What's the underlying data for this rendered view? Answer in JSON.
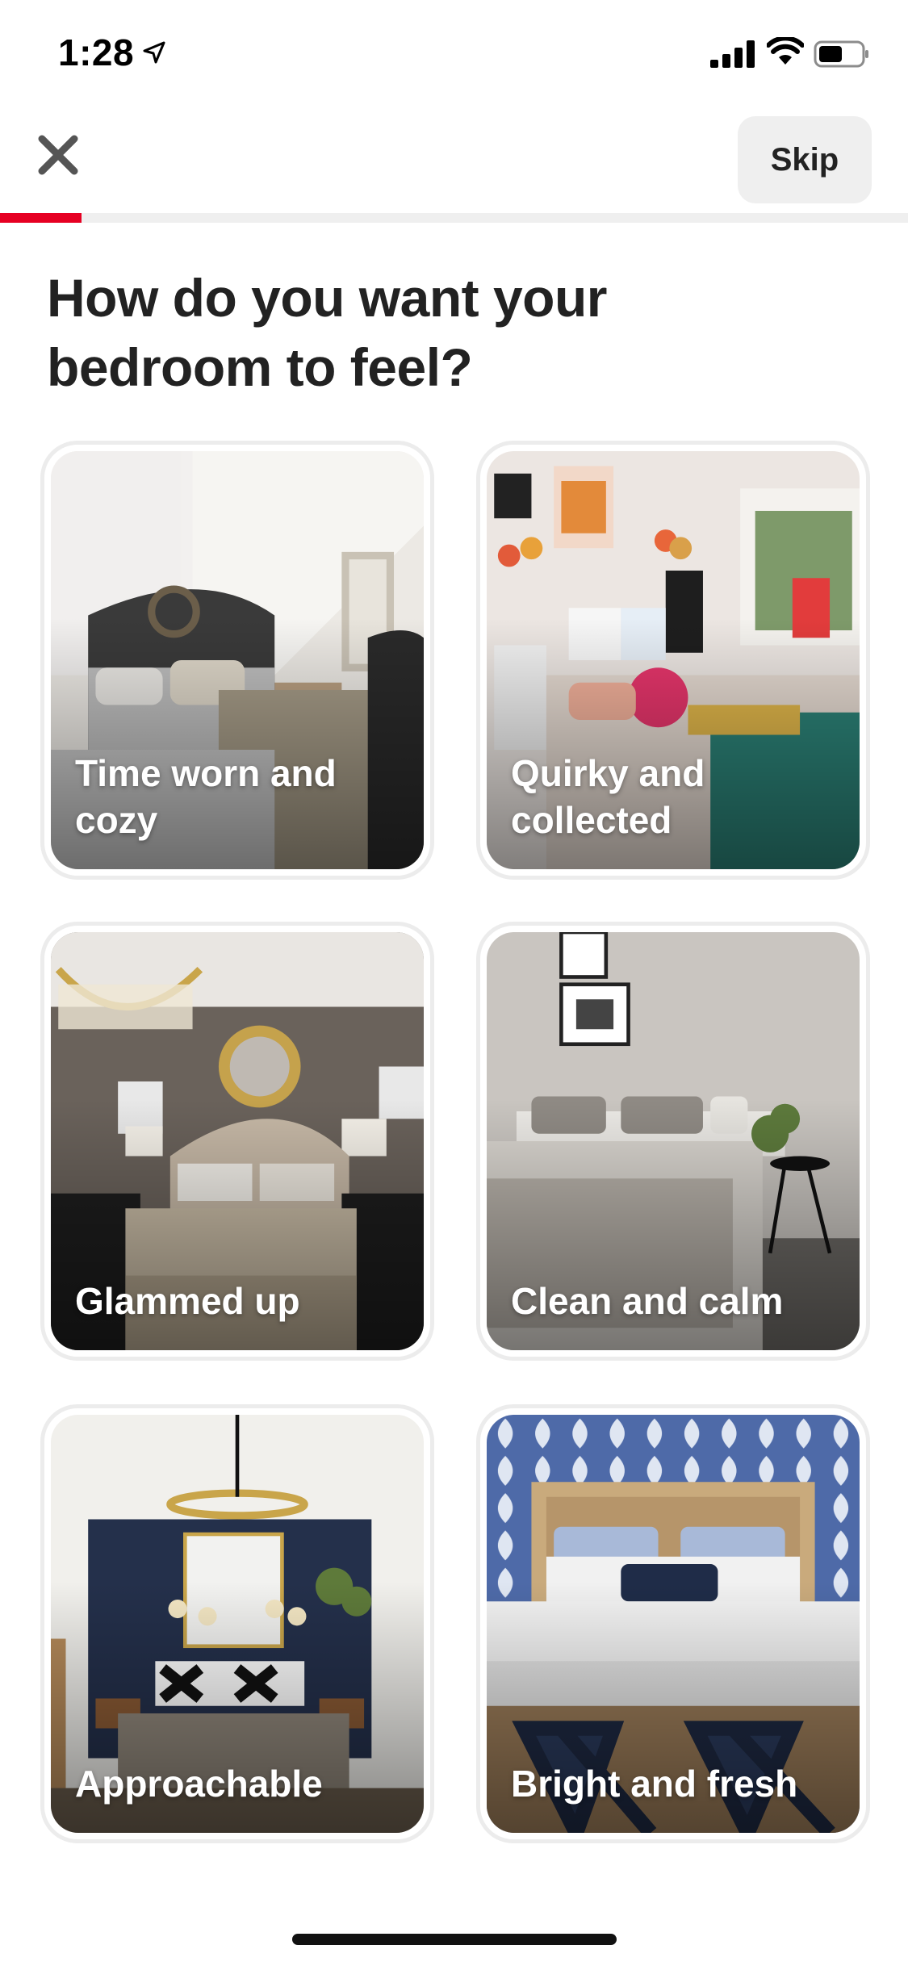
{
  "status_bar": {
    "time": "1:28",
    "icons": [
      "location-arrow-icon",
      "signal-icon",
      "wifi-icon",
      "battery-icon"
    ]
  },
  "header": {
    "close_icon": "close-icon",
    "skip_label": "Skip"
  },
  "progress": {
    "value": 0.09,
    "accent_color": "#e60023"
  },
  "title": "How do you want your bedroom to feel?",
  "options": [
    {
      "label": "Time worn and cozy"
    },
    {
      "label": "Quirky and collected"
    },
    {
      "label": "Glammed up"
    },
    {
      "label": "Clean and calm"
    },
    {
      "label": "Approachable"
    },
    {
      "label": "Bright and fresh"
    }
  ]
}
